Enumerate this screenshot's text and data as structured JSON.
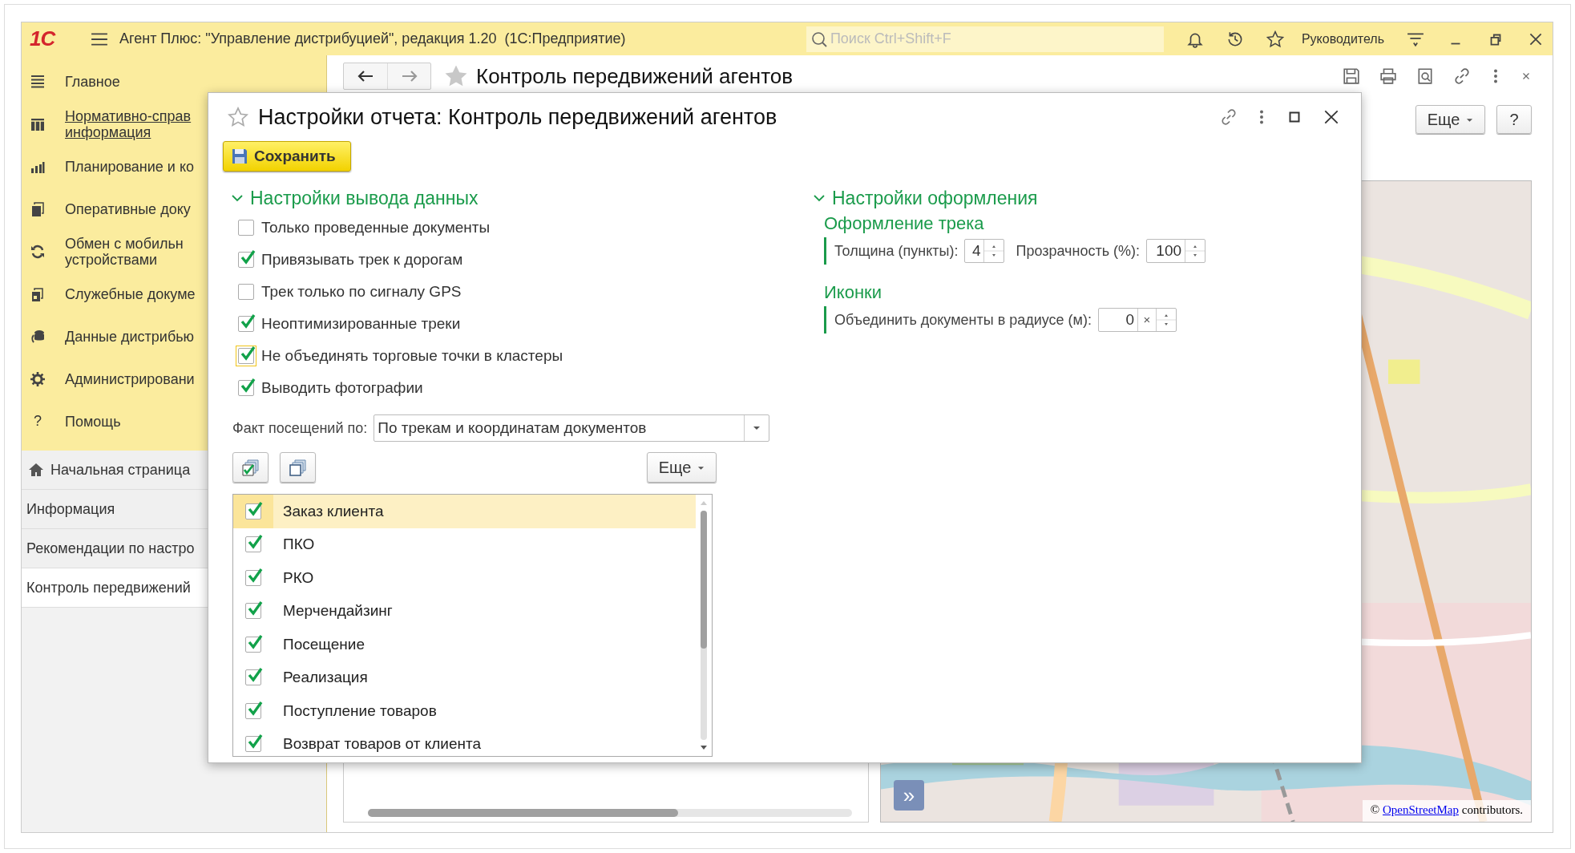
{
  "app_bar": {
    "logo": "1С",
    "title": "Агент Плюс: \"Управление дистрибуцией\", редакция 1.20  (1С:Предприятие)",
    "search": {
      "placeholder": "Поиск Ctrl+Shift+F"
    },
    "user": "Руководитель"
  },
  "sidebar": {
    "sections": [
      {
        "label": "Главное",
        "hovered": false
      },
      {
        "label": "Нормативно-справ\nинформация",
        "hovered": true
      },
      {
        "label": "Планирование и ко",
        "hovered": false
      },
      {
        "label": "Оперативные доку",
        "hovered": false
      },
      {
        "label": "Обмен с мобильн\nустройствами",
        "hovered": false
      },
      {
        "label": "Служебные докуме",
        "hovered": false
      },
      {
        "label": "Данные дистрибью",
        "hovered": false
      },
      {
        "label": "Администрировани",
        "hovered": false
      },
      {
        "label": "Помощь",
        "hovered": false,
        "glyph": "?"
      }
    ],
    "open_windows": [
      {
        "label": "Начальная страница",
        "selected": false,
        "home": true
      },
      {
        "label": "Информация",
        "selected": false
      },
      {
        "label": "Рекомендации по настро",
        "selected": false
      },
      {
        "label": "Контроль передвижений",
        "selected": true
      }
    ]
  },
  "report": {
    "title": "Контроль передвижений агентов",
    "more_button": "Еще",
    "help_button": "?",
    "map": {
      "expand_button": "»",
      "attribution": {
        "prefix": "©",
        "link": "OpenStreetMap",
        "suffix": "contributors."
      }
    }
  },
  "dialog": {
    "title": "Настройки отчета: Контроль передвижений агентов",
    "save_button": "Сохранить",
    "output_section": {
      "title": "Настройки вывода данных",
      "expanded": true,
      "options": [
        {
          "label": "Только проведенные документы",
          "checked": false,
          "focused": false
        },
        {
          "label": "Привязывать трек к дорогам",
          "checked": true,
          "focused": false
        },
        {
          "label": "Трек только по сигналу GPS",
          "checked": false,
          "focused": false
        },
        {
          "label": "Неоптимизированные треки",
          "checked": true,
          "focused": false
        },
        {
          "label": "Не объединять торговые точки в кластеры",
          "checked": true,
          "focused": true
        },
        {
          "label": "Выводить фотографии",
          "checked": true,
          "focused": false
        }
      ],
      "visit_field": {
        "label": "Факт посещений по:",
        "value": "По трекам и координатам документов"
      },
      "list_more_button": "Еще",
      "documents": [
        {
          "label": "Заказ клиента",
          "checked": true,
          "selected": true
        },
        {
          "label": "ПКО",
          "checked": true,
          "selected": false
        },
        {
          "label": "РКО",
          "checked": true,
          "selected": false
        },
        {
          "label": "Мерчендайзинг",
          "checked": true,
          "selected": false
        },
        {
          "label": "Посещение",
          "checked": true,
          "selected": false
        },
        {
          "label": "Реализация",
          "checked": true,
          "selected": false
        },
        {
          "label": "Поступление товаров",
          "checked": true,
          "selected": false
        },
        {
          "label": "Возврат товаров от клиента",
          "checked": true,
          "selected": false
        }
      ]
    },
    "design_section": {
      "title": "Настройки оформления",
      "expanded": true,
      "track": {
        "title": "Оформление трека",
        "width": {
          "label": "Толщина (пункты):",
          "value": "4"
        },
        "opacity": {
          "label": "Прозрачность (%):",
          "value": "100"
        }
      },
      "icons": {
        "title": "Иконки",
        "merge_radius": {
          "label": "Объединить документы в радиусе (м):",
          "value": "0",
          "clear": "×"
        }
      }
    }
  }
}
